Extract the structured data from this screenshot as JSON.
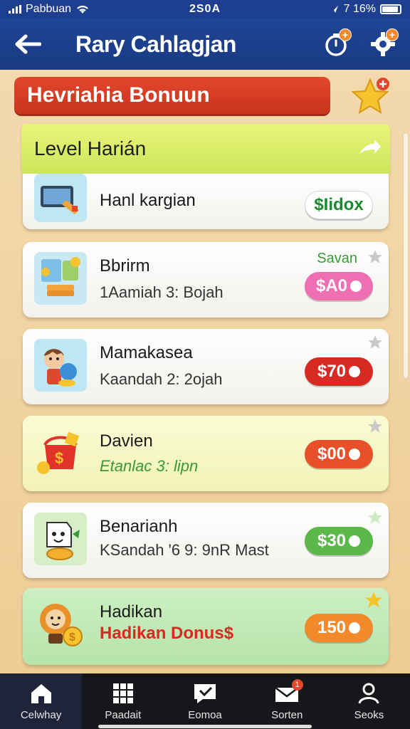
{
  "status_bar": {
    "carrier": "Pabbuan",
    "time": "2S0A",
    "battery": "7 16%"
  },
  "header": {
    "title": "Rary Cahlagjan"
  },
  "banner": {
    "label": "Hevriahia Bonuun"
  },
  "level_section": {
    "title": "Level Harián"
  },
  "cards": [
    {
      "title": "Hanl kargian",
      "subtitle": "",
      "reward": "$Iidox",
      "pill_color": "#ffffff",
      "pill_text_color": "#1b8a2f",
      "tag": ""
    },
    {
      "title": "Bbrirm",
      "subtitle": "1Aamiah 3: Bojah",
      "reward": "$A0",
      "pill_color": "#ef6fb3",
      "tag": "Savan"
    },
    {
      "title": "Mamakasea",
      "subtitle": "Kaandah 2: 2ojah",
      "reward": "$70",
      "pill_color": "#d62a22",
      "tag": ""
    },
    {
      "title": "Davien",
      "subtitle": "Etanlac 3: lipn",
      "reward": "$00",
      "pill_color": "#e8502a",
      "tag": ""
    },
    {
      "title": "Benarianh",
      "subtitle": "KSandah '6 9: 9nR Mast",
      "reward": "$30",
      "pill_color": "#5cb84a",
      "tag": ""
    },
    {
      "title": "Hadikan",
      "subtitle": "Hadikan Donus$",
      "reward": "150",
      "pill_color": "#f28a2b",
      "tag": ""
    }
  ],
  "bottom_nav": [
    {
      "label": "Celwhay",
      "icon": "home-icon"
    },
    {
      "label": "Paadait",
      "icon": "grid-icon"
    },
    {
      "label": "Eomoa",
      "icon": "chat-icon"
    },
    {
      "label": "Sorten",
      "icon": "inbox-icon",
      "badge": "1"
    },
    {
      "label": "Seoks",
      "icon": "profile-icon"
    }
  ],
  "colors": {
    "header_blue": "#1f4596",
    "banner_red": "#e2472b",
    "level_lime": "#dff06e",
    "bg_tan": "#f0d3a2"
  }
}
